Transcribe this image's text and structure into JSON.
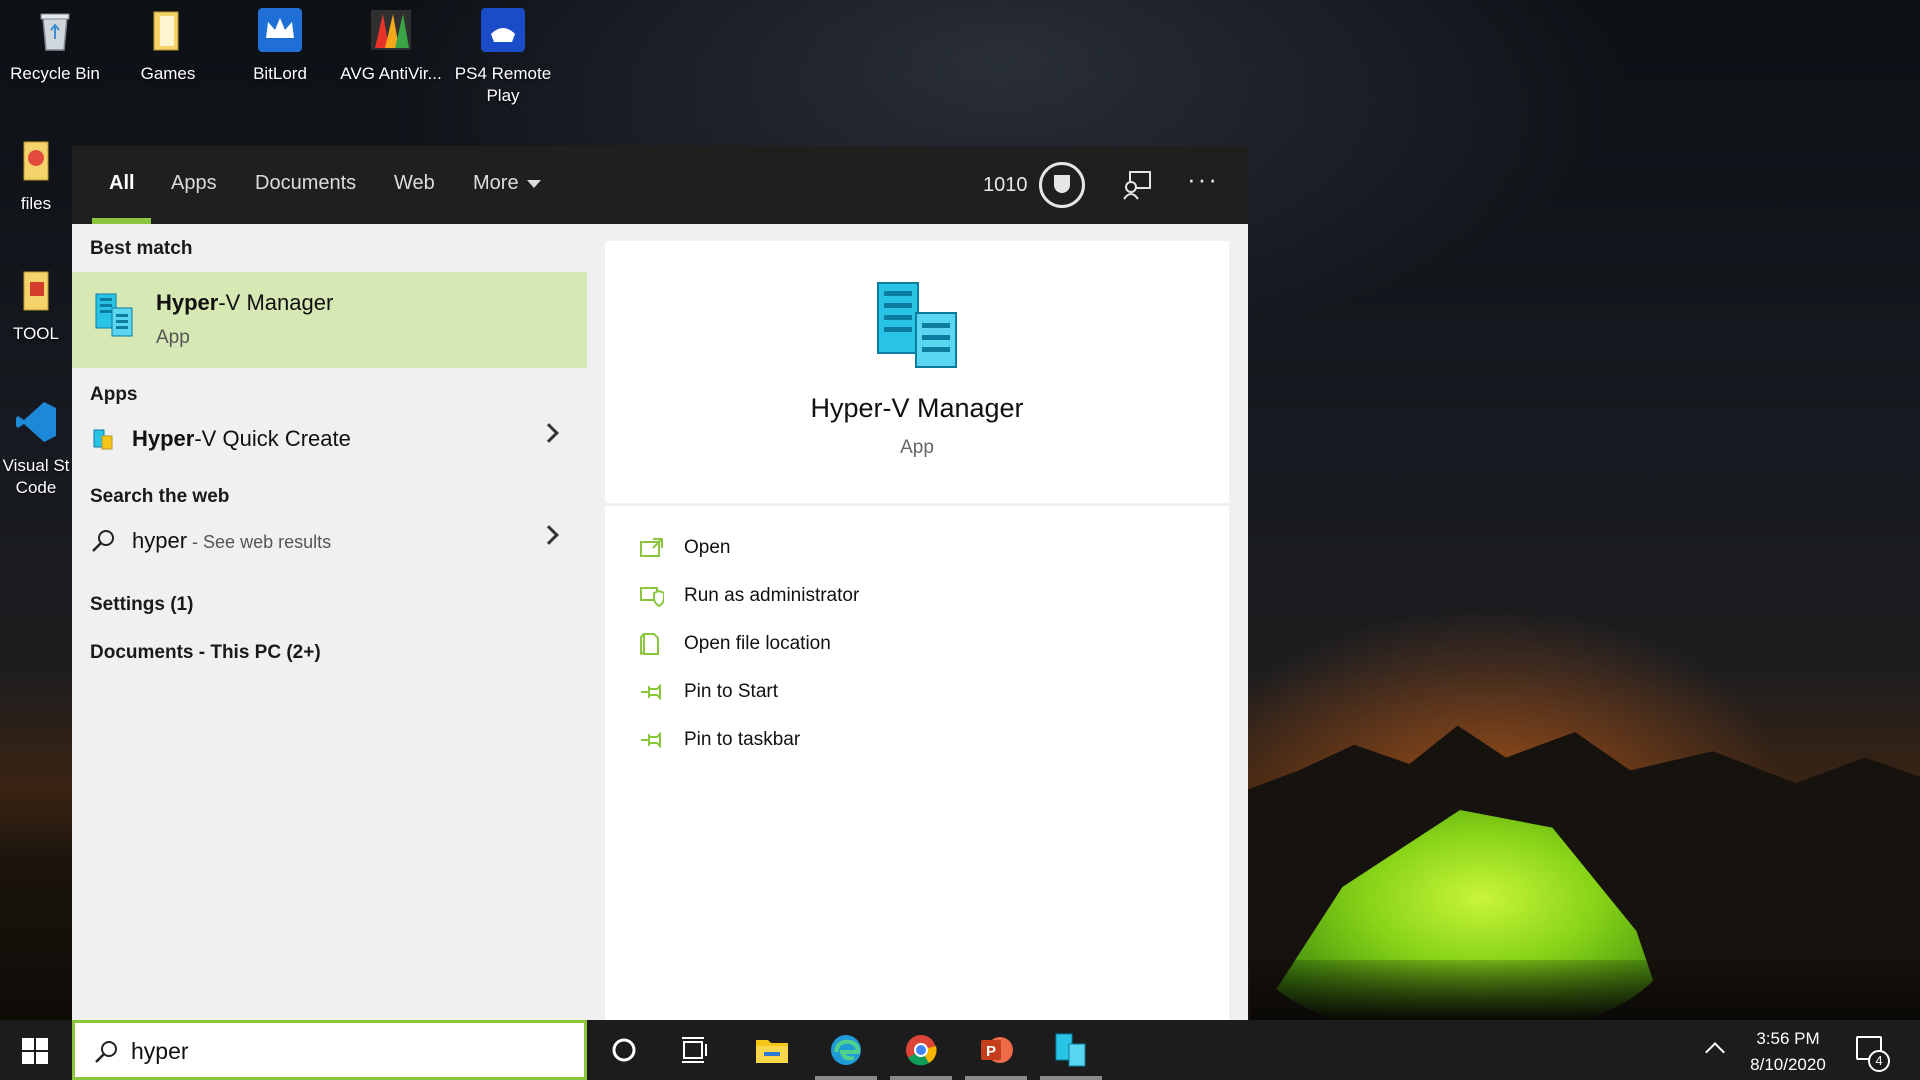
{
  "desktop": {
    "icons": [
      {
        "label": "Recycle Bin"
      },
      {
        "label": "Games"
      },
      {
        "label": "BitLord"
      },
      {
        "label": "AVG AntiVir..."
      },
      {
        "label": "PS4 Remote Play"
      },
      {
        "label": "files"
      },
      {
        "label": "TOOL"
      },
      {
        "label": "Visual St Code"
      }
    ]
  },
  "search_panel": {
    "tabs": [
      {
        "label": "All",
        "active": true
      },
      {
        "label": "Apps"
      },
      {
        "label": "Documents"
      },
      {
        "label": "Web"
      },
      {
        "label": "More"
      }
    ],
    "points": "1010",
    "best_match": {
      "heading": "Best match",
      "name_bold": "Hyper",
      "name_rest": "-V Manager",
      "type": "App"
    },
    "apps": {
      "heading": "Apps",
      "items": [
        {
          "name_bold": "Hyper",
          "name_rest": "-V Quick Create"
        }
      ]
    },
    "web": {
      "heading": "Search the web",
      "query": "hyper",
      "suffix": " - See web results"
    },
    "settings_label": "Settings (1)",
    "documents_label": "Documents - This PC (2+)",
    "preview": {
      "title": "Hyper-V Manager",
      "type": "App",
      "actions": [
        {
          "label": "Open",
          "icon": "open-icon"
        },
        {
          "label": "Run as administrator",
          "icon": "shield-icon"
        },
        {
          "label": "Open file location",
          "icon": "file-location-icon"
        },
        {
          "label": "Pin to Start",
          "icon": "pin-icon"
        },
        {
          "label": "Pin to taskbar",
          "icon": "pin-icon"
        }
      ]
    }
  },
  "taskbar": {
    "search_value": "hyper",
    "clock_time": "3:56 PM",
    "clock_date": "8/10/2020",
    "notification_count": "4",
    "apps": [
      "cortana-icon",
      "task-view-icon",
      "file-explorer-icon",
      "edge-icon",
      "chrome-icon",
      "powerpoint-icon",
      "hyper-v-manager-icon"
    ]
  },
  "colors": {
    "accent": "#8cc63f",
    "best_match_bg": "#d6e8b3",
    "hyperv_cyan": "#29c3e6"
  }
}
